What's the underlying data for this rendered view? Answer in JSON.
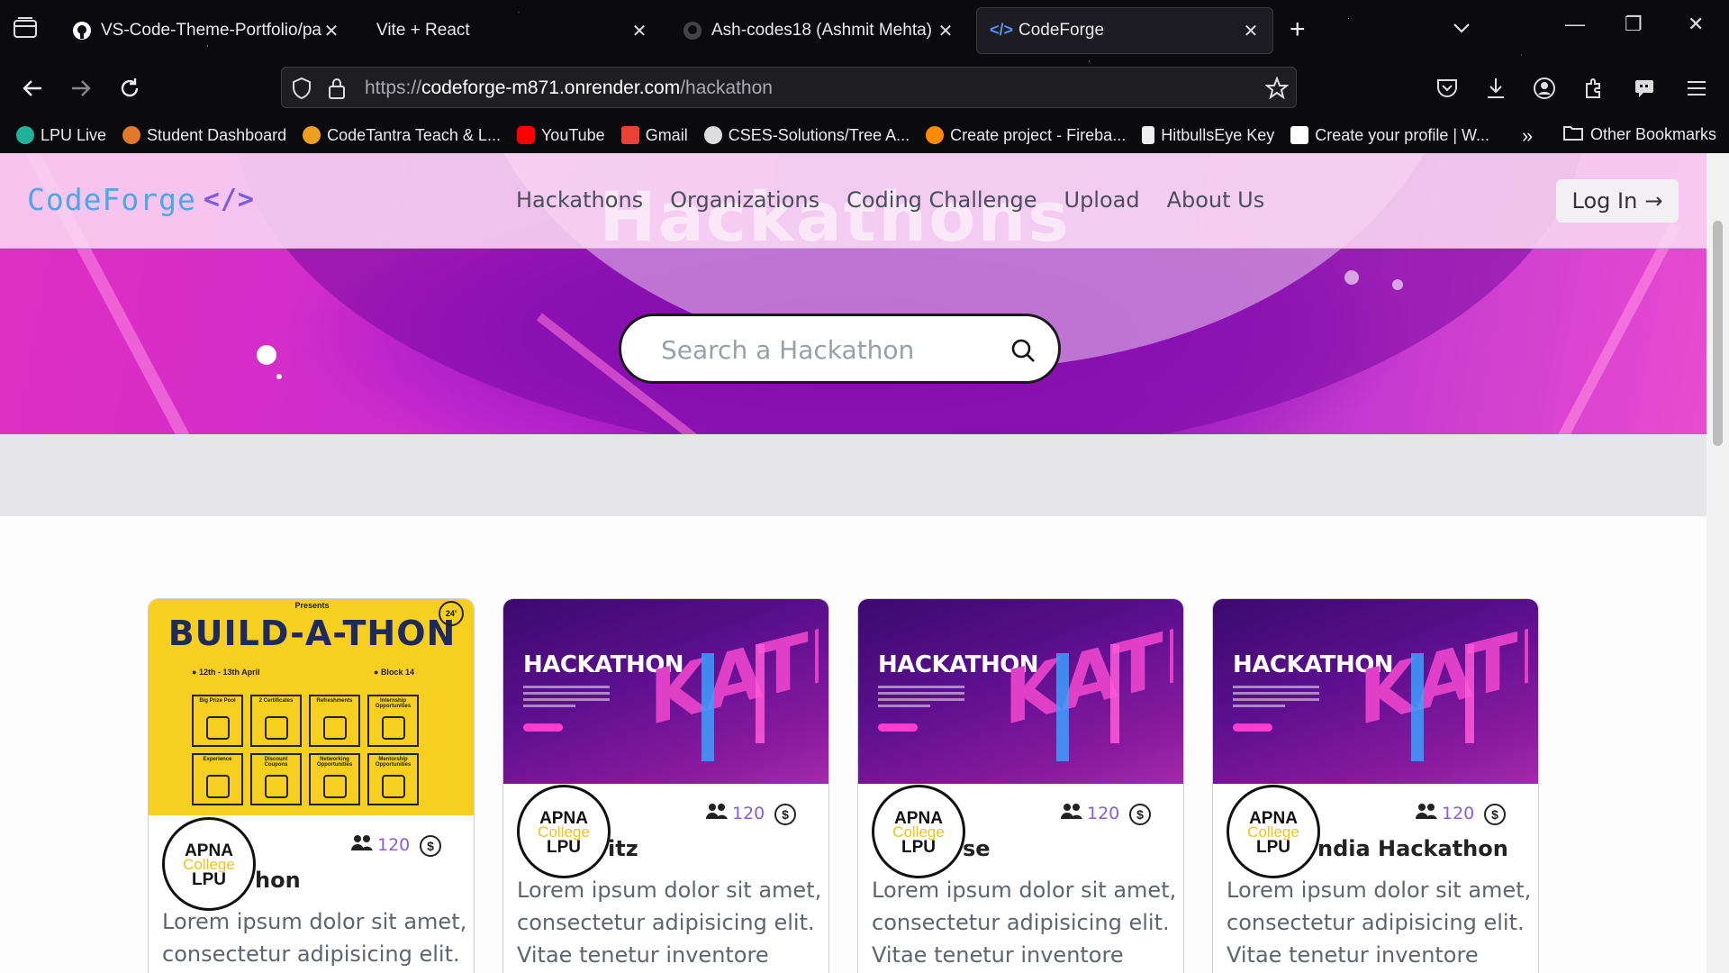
{
  "browser": {
    "tabs": [
      {
        "title": "VS-Code-Theme-Portfolio/page",
        "icon": "github-icon"
      },
      {
        "title": "Vite + React",
        "icon": ""
      },
      {
        "title": "Ash-codes18 (Ashmit Mehta)",
        "icon": "github-icon"
      },
      {
        "title": "CodeForge",
        "icon": "code-icon",
        "active": true
      }
    ],
    "url": {
      "prefix": "https://",
      "host": "codeforge-m871.onrender.com",
      "path": "/hackathon"
    },
    "bookmarks": [
      {
        "label": "LPU Live",
        "color": "#1fb39a"
      },
      {
        "label": "Student Dashboard",
        "color": "#e07a2a"
      },
      {
        "label": "CodeTantra Teach & L...",
        "color": "#f0a020"
      },
      {
        "label": "YouTube",
        "color": "#ff0000"
      },
      {
        "label": "Gmail",
        "color": "#ea4335"
      },
      {
        "label": "CSES-Solutions/Tree A...",
        "color": "#dddddd"
      },
      {
        "label": "Create project - Fireba...",
        "color": "#ff8a00"
      },
      {
        "label": "HitbullsEye Key",
        "color": "#eeeeee"
      },
      {
        "label": "Create your profile | W...",
        "color": "#ffffff"
      }
    ],
    "other_bookmarks": "Other Bookmarks"
  },
  "site": {
    "logo": "CodeForge",
    "ghost_title": "Hackathons",
    "nav": [
      "Hackathons",
      "Organizations",
      "Coding Challenge",
      "Upload",
      "About Us"
    ],
    "login": "Log In",
    "search_placeholder": "Search a Hackathon"
  },
  "cards": [
    {
      "poster": {
        "presents": "Presents",
        "title": "BUILD-A-THON",
        "badge": "24'",
        "date": "12th - 13th April",
        "location": "Block 14",
        "boxes": [
          "Big Prize Pool",
          "2 Certificates",
          "Refreshments",
          "Internship Opportunities",
          "Experience",
          "Discount Coupons",
          "Networking Opportunities",
          "Mentorship Opportunities"
        ]
      },
      "avatar": {
        "line1": "APNA",
        "line2": "College",
        "line3": "LPU"
      },
      "members": "120",
      "title": "Build-a-thon",
      "title_visible": "hon",
      "desc": "Lorem ipsum dolor sit amet, consectetur adipisicing elit."
    },
    {
      "poster": {
        "title": "HACKATHON",
        "art": "KATHON"
      },
      "avatar": {
        "line1": "APNA",
        "line2": "College",
        "line3": "LPU"
      },
      "members": "120",
      "title_visible": "itz",
      "desc": "Lorem ipsum dolor sit amet, consectetur adipisicing elit. Vitae tenetur inventore"
    },
    {
      "poster": {
        "title": "HACKATHON",
        "art": "KATHON"
      },
      "avatar": {
        "line1": "APNA",
        "line2": "College",
        "line3": "LPU"
      },
      "members": "120",
      "title_visible": "se",
      "desc": "Lorem ipsum dolor sit amet, consectetur adipisicing elit. Vitae tenetur inventore"
    },
    {
      "poster": {
        "title": "HACKATHON",
        "art": "KATHON"
      },
      "avatar": {
        "line1": "APNA",
        "line2": "College",
        "line3": "LPU"
      },
      "members": "120",
      "title_visible": "ndia Hackathon",
      "desc": "Lorem ipsum dolor sit amet, consectetur adipisicing elit. Vitae tenetur inventore"
    }
  ]
}
